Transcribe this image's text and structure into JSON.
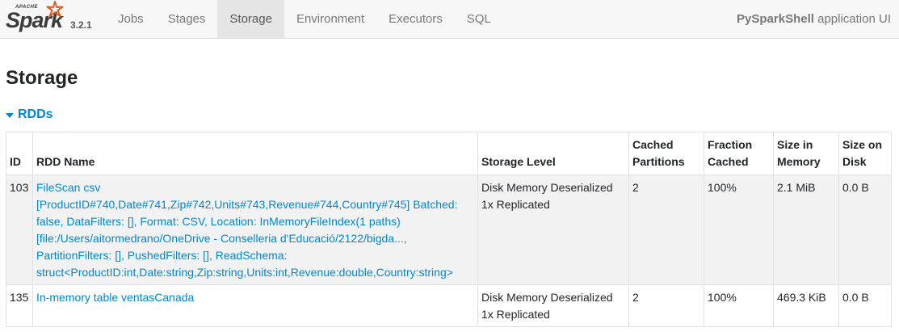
{
  "brand": {
    "apache": "APACHE",
    "spark": "Spark",
    "version": "3.2.1"
  },
  "nav": {
    "tabs": [
      {
        "label": "Jobs",
        "active": false
      },
      {
        "label": "Stages",
        "active": false
      },
      {
        "label": "Storage",
        "active": true
      },
      {
        "label": "Environment",
        "active": false
      },
      {
        "label": "Executors",
        "active": false
      },
      {
        "label": "SQL",
        "active": false
      }
    ],
    "app_name_bold": "PySparkShell",
    "app_name_suffix": " application UI"
  },
  "page": {
    "title": "Storage",
    "section": "RDDs"
  },
  "table": {
    "headers": [
      "ID",
      "RDD Name",
      "Storage Level",
      "Cached Partitions",
      "Fraction Cached",
      "Size in Memory",
      "Size on Disk"
    ],
    "rows": [
      {
        "id": "103",
        "name": "FileScan csv [ProductID#740,Date#741,Zip#742,Units#743,Revenue#744,Country#745] Batched: false, DataFilters: [], Format: CSV, Location: InMemoryFileIndex(1 paths)[file:/Users/aitormedrano/OneDrive - Conselleria d'Educació/2122/bigda..., PartitionFilters: [], PushedFilters: [], ReadSchema: struct<ProductID:int,Date:string,Zip:string,Units:int,Revenue:double,Country:string>",
        "storage_level": "Disk Memory Deserialized 1x Replicated",
        "cached_partitions": "2",
        "fraction_cached": "100%",
        "size_in_memory": "2.1 MiB",
        "size_on_disk": "0.0 B"
      },
      {
        "id": "135",
        "name": "In-memory table ventasCanada",
        "storage_level": "Disk Memory Deserialized 1x Replicated",
        "cached_partitions": "2",
        "fraction_cached": "100%",
        "size_in_memory": "469.3 KiB",
        "size_on_disk": "0.0 B"
      }
    ]
  },
  "colors": {
    "link": "#0088cc",
    "brand_star": "#e25a1c",
    "nav_bg": "#f7f7f7"
  }
}
